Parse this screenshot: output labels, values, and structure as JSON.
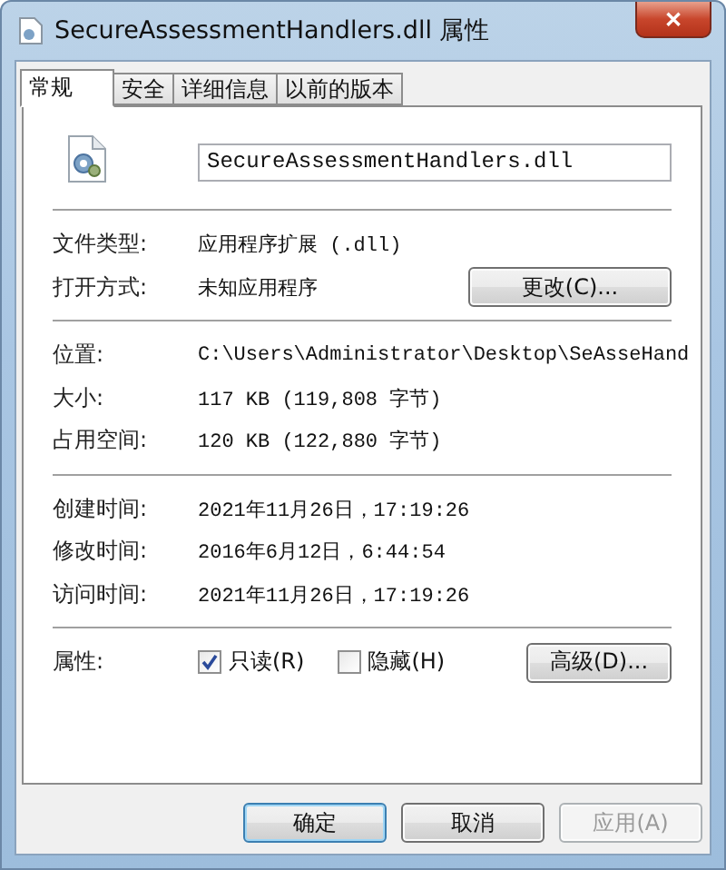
{
  "window": {
    "title": "SecureAssessmentHandlers.dll 属性",
    "close": "✕"
  },
  "tabs": [
    {
      "label": "常规",
      "selected": true
    },
    {
      "label": "安全",
      "selected": false
    },
    {
      "label": "详细信息",
      "selected": false
    },
    {
      "label": "以前的版本",
      "selected": false
    }
  ],
  "file_name": "SecureAssessmentHandlers.dll",
  "sections": [
    [
      {
        "label": "文件类型:",
        "value": "应用程序扩展 (.dll)"
      },
      {
        "label": "打开方式:",
        "value": "未知应用程序",
        "button": "更改(C)..."
      }
    ],
    [
      {
        "label": "位置:",
        "value": "C:\\Users\\Administrator\\Desktop\\SeAsseHand"
      },
      {
        "label": "大小:",
        "value": "117 KB (119,808 字节)"
      },
      {
        "label": "占用空间:",
        "value": "120 KB (122,880 字节)"
      }
    ],
    [
      {
        "label": "创建时间:",
        "value": "2021年11月26日，17:19:26"
      },
      {
        "label": "修改时间:",
        "value": "2016年6月12日，6:44:54"
      },
      {
        "label": "访问时间:",
        "value": "2021年11月26日，17:19:26"
      }
    ]
  ],
  "attributes": {
    "label": "属性:",
    "checkboxes": [
      {
        "label": "只读(R)",
        "checked": true
      },
      {
        "label": "隐藏(H)",
        "checked": false
      }
    ],
    "button": "高级(D)..."
  },
  "buttons": [
    {
      "label": "确定",
      "default": true,
      "disabled": false
    },
    {
      "label": "取消",
      "default": false,
      "disabled": false
    },
    {
      "label": "应用(A)",
      "default": false,
      "disabled": true
    }
  ]
}
